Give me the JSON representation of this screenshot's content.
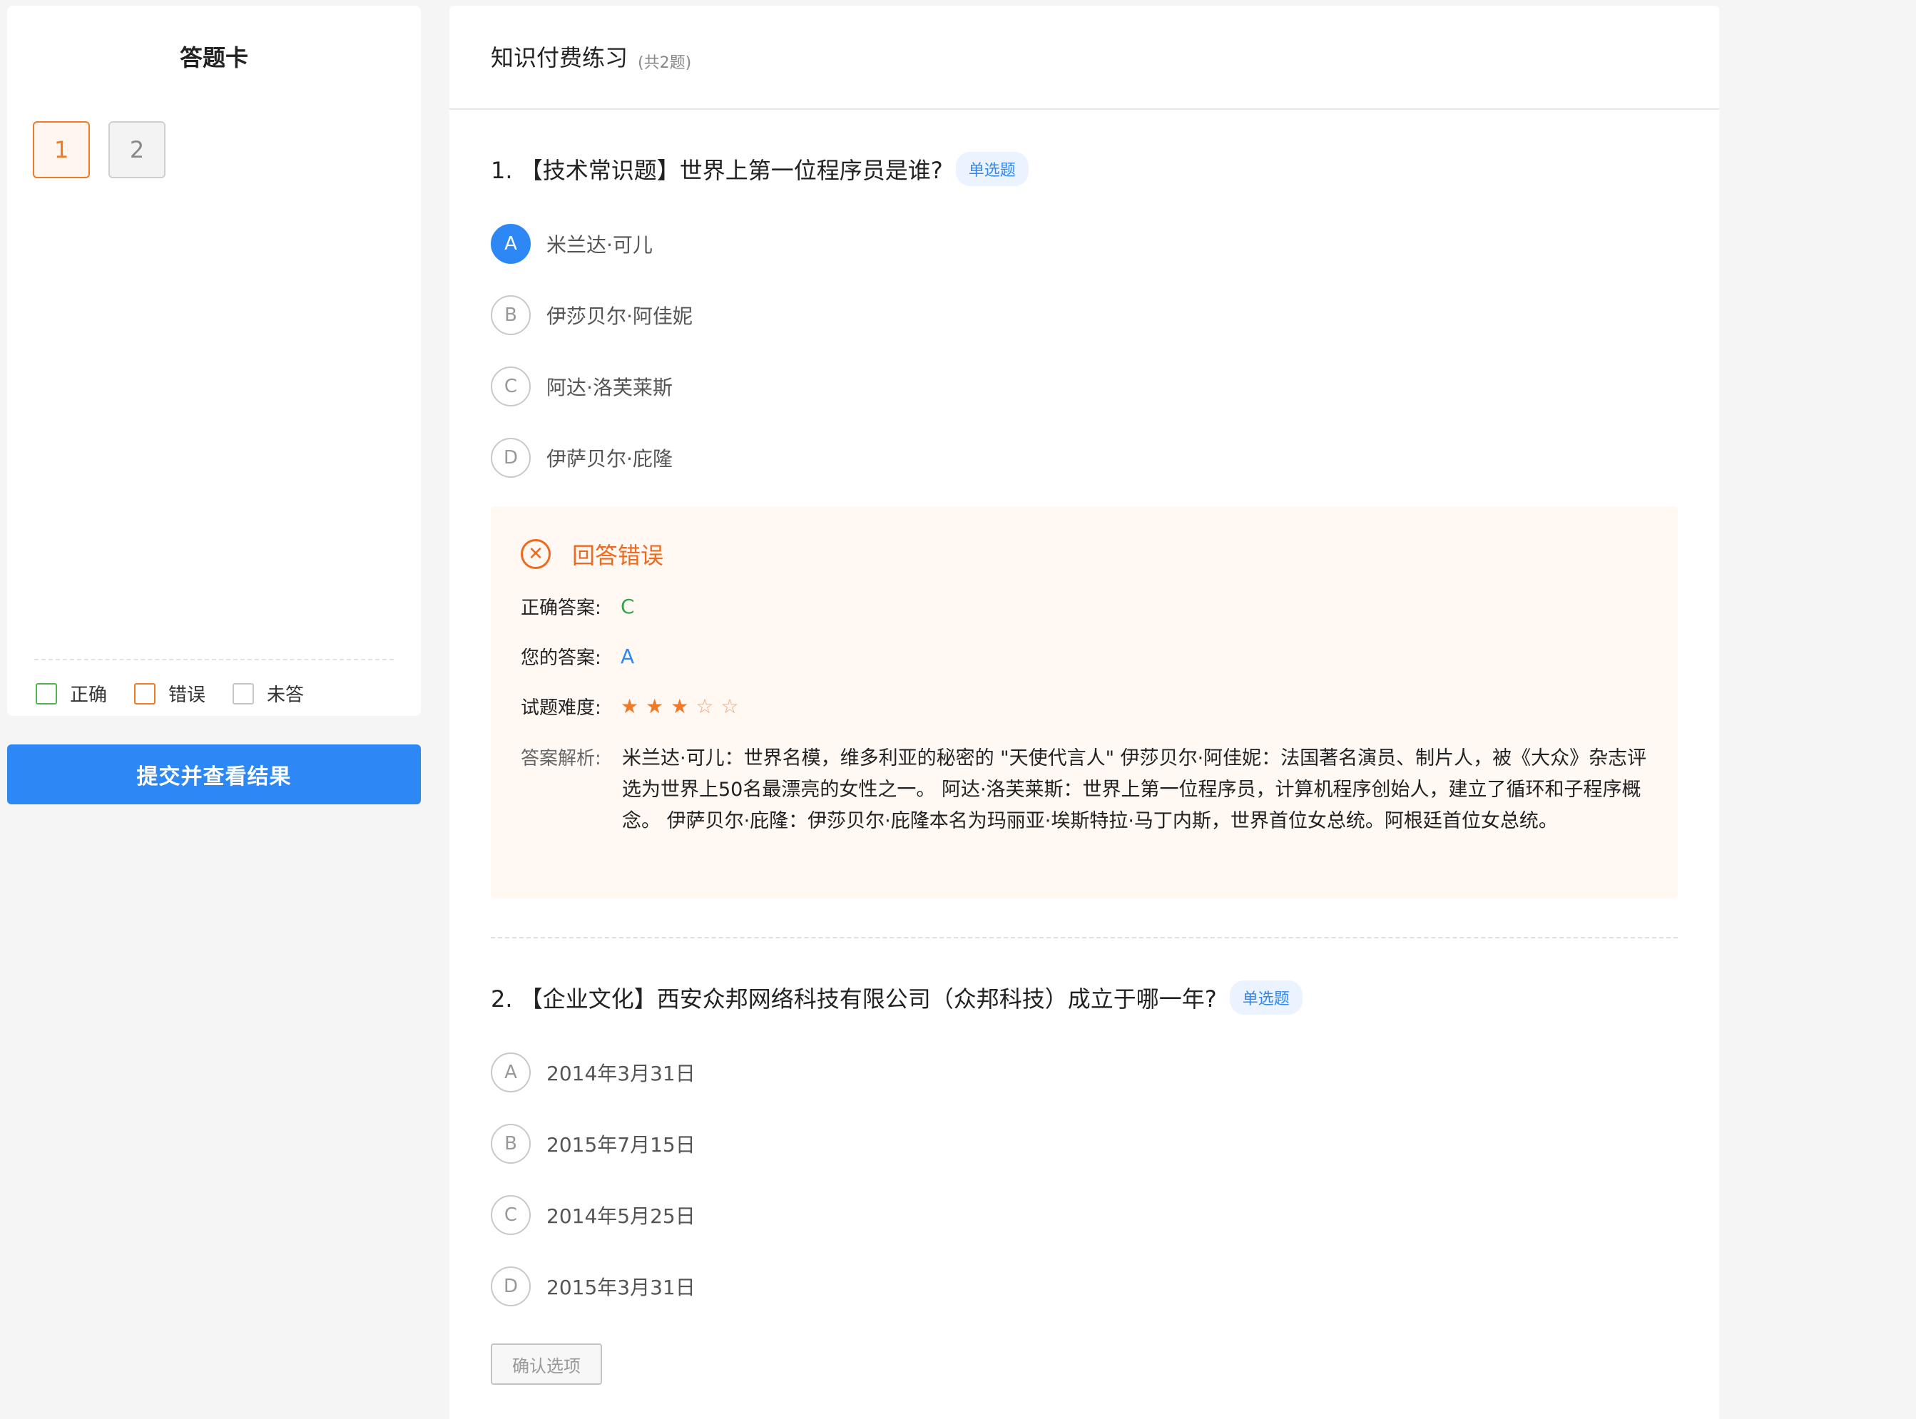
{
  "answer_card": {
    "title": "答题卡",
    "questions": [
      {
        "number": "1",
        "status": "wrong"
      },
      {
        "number": "2",
        "status": "unanswered"
      }
    ],
    "legend": {
      "correct": "正确",
      "wrong": "错误",
      "unanswered": "未答"
    },
    "submit_label": "提交并查看结果"
  },
  "main": {
    "title": "知识付费练习",
    "count": "(共2题)"
  },
  "q1": {
    "title": "1. 【技术常识题】世界上第一位程序员是谁?",
    "type": "单选题",
    "options": [
      {
        "letter": "A",
        "text": "米兰达·可儿",
        "selected": true
      },
      {
        "letter": "B",
        "text": "伊莎贝尔·阿佳妮",
        "selected": false
      },
      {
        "letter": "C",
        "text": "阿达·洛芙莱斯",
        "selected": false
      },
      {
        "letter": "D",
        "text": "伊萨贝尔·庇隆",
        "selected": false
      }
    ],
    "result": {
      "status": "回答错误",
      "correct_label": "正确答案:",
      "correct_value": "C",
      "your_label": "您的答案:",
      "your_value": "A",
      "difficulty_label": "试题难度:",
      "difficulty_stars": 3,
      "difficulty_max": 5,
      "analysis_label": "答案解析:",
      "analysis_text": "米兰达·可儿：世界名模，维多利亚的秘密的 \"天使代言人\" 伊莎贝尔·阿佳妮：法国著名演员、制片人，被《大众》杂志评选为世界上50名最漂亮的女性之一。 阿达·洛芙莱斯：世界上第一位程序员，计算机程序创始人，建立了循环和子程序概念。 伊萨贝尔·庇隆：伊莎贝尔·庇隆本名为玛丽亚·埃斯特拉·马丁内斯，世界首位女总统。阿根廷首位女总统。"
    }
  },
  "q2": {
    "title": "2. 【企业文化】西安众邦网络科技有限公司（众邦科技）成立于哪一年?",
    "type": "单选题",
    "options": [
      {
        "letter": "A",
        "text": "2014年3月31日"
      },
      {
        "letter": "B",
        "text": "2015年7月15日"
      },
      {
        "letter": "C",
        "text": "2014年5月25日"
      },
      {
        "letter": "D",
        "text": "2015年3月31日"
      }
    ],
    "confirm_label": "确认选项"
  }
}
